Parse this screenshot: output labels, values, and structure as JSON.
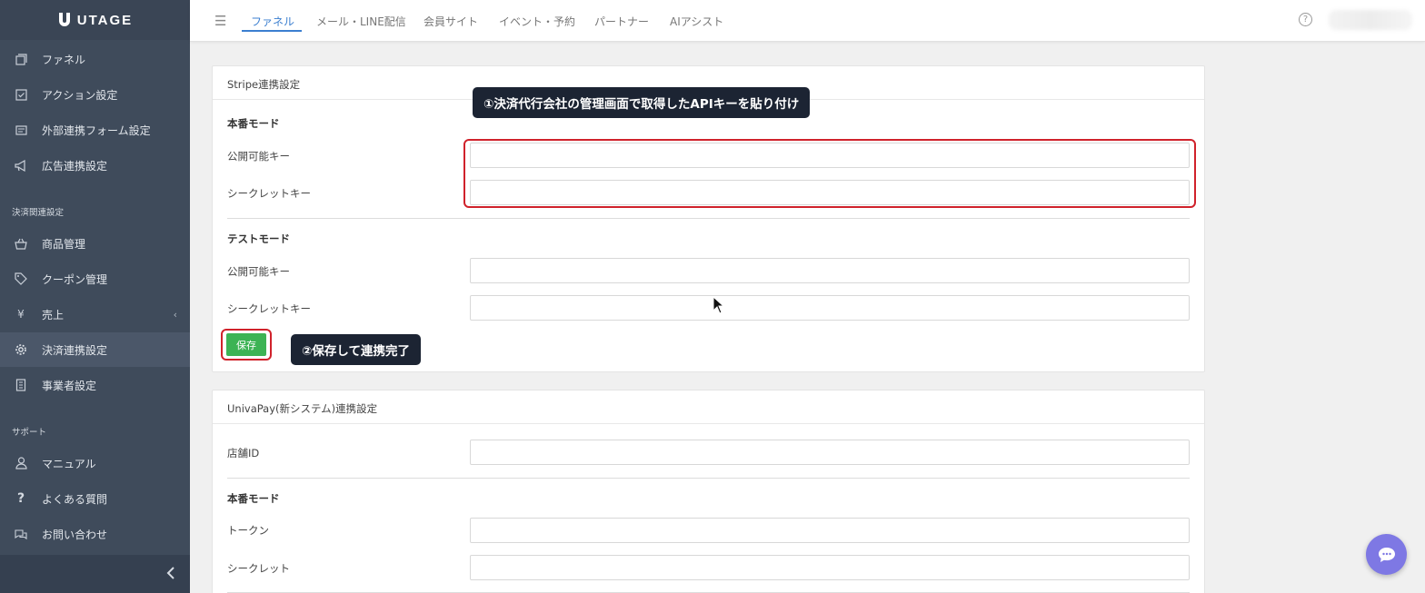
{
  "app": {
    "logo_text": "UTAGE"
  },
  "sidebar": {
    "items": [
      {
        "label": "ファネル",
        "icon": "funnel-icon"
      },
      {
        "label": "アクション設定",
        "icon": "checklist-icon"
      },
      {
        "label": "外部連携フォーム設定",
        "icon": "form-icon"
      },
      {
        "label": "広告連携設定",
        "icon": "megaphone-icon"
      },
      {
        "label": "商品管理",
        "icon": "basket-icon"
      },
      {
        "label": "クーポン管理",
        "icon": "tag-icon"
      },
      {
        "label": "売上",
        "icon": "yen-icon"
      },
      {
        "label": "決済連携設定",
        "icon": "gear-icon"
      },
      {
        "label": "事業者設定",
        "icon": "building-icon"
      },
      {
        "label": "マニュアル",
        "icon": "person-icon"
      },
      {
        "label": "よくある質問",
        "icon": "question-icon"
      },
      {
        "label": "お問い合わせ",
        "icon": "chat-bubbles-icon"
      }
    ],
    "sections": {
      "payment": "決済関連設定",
      "support": "サポート"
    },
    "active_item": "決済連携設定"
  },
  "topnav": {
    "tabs": [
      "ファネル",
      "メール・LINE配信",
      "会員サイト",
      "イベント・予約",
      "パートナー",
      "AIアシスト"
    ],
    "active_tab": "ファネル"
  },
  "stripe": {
    "title": "Stripe連携設定",
    "live_mode": "本番モード",
    "test_mode": "テストモード",
    "publishable_key_label": "公開可能キー",
    "secret_key_label": "シークレットキー",
    "live_publishable_value": "",
    "live_secret_value": "",
    "test_publishable_value": "",
    "test_secret_value": "",
    "save_label": "保存"
  },
  "univapay": {
    "title": "UnivaPay(新システム)連携設定",
    "store_id_label": "店舗ID",
    "live_mode": "本番モード",
    "token_label": "トークン",
    "secret_label": "シークレット",
    "store_id_value": "",
    "token_value": "",
    "secret_value": ""
  },
  "annotations": {
    "callout_1": "①決済代行会社の管理画面で取得したAPIキーを貼り付け",
    "callout_2": "②保存して連携完了"
  },
  "colors": {
    "sidebar_bg": "#3f4b5b",
    "accent_blue": "#3b7fd0",
    "save_green": "#3cb354",
    "highlight_red": "#d0222b",
    "callout_bg": "#1c2433",
    "chat_purple": "#7e78e4"
  }
}
